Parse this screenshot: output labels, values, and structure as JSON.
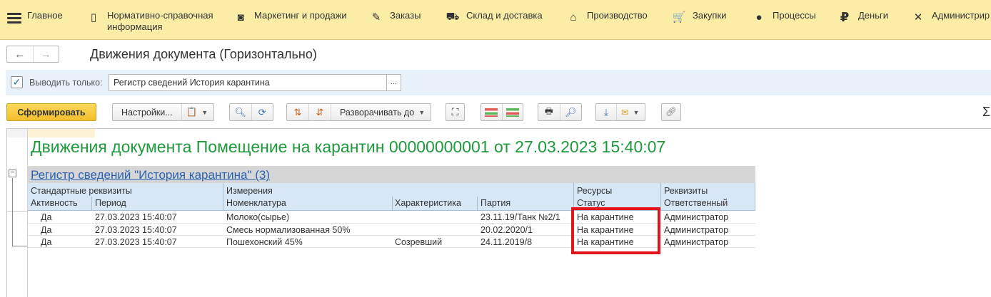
{
  "menu": {
    "items": [
      {
        "label": "Главное",
        "icon": "☰"
      },
      {
        "label": "Нормативно-справочная\nинформация",
        "icon": "▯"
      },
      {
        "label": "Маркетинг и продажи",
        "icon": "◙"
      },
      {
        "label": "Заказы",
        "icon": "✎"
      },
      {
        "label": "Склад и доставка",
        "icon": "⛟"
      },
      {
        "label": "Производство",
        "icon": "⌂"
      },
      {
        "label": "Закупки",
        "icon": "🛒"
      },
      {
        "label": "Процессы",
        "icon": "●"
      },
      {
        "label": "Деньги",
        "icon": "₽"
      },
      {
        "label": "Администрир",
        "icon": "✕"
      }
    ]
  },
  "title_bar": {
    "back": "←",
    "forward": "→",
    "title": "Движения документа (Горизонтально)"
  },
  "filter": {
    "checked": true,
    "check_mark": "✓",
    "label": "Выводить только:",
    "value": "Регистр сведений История карантина",
    "dots": "..."
  },
  "toolbar": {
    "generate_label": "Сформировать",
    "settings_label": "Настройки...",
    "expand_label": "Разворачивать до",
    "sigma": "Σ"
  },
  "report": {
    "title": "Движения документа Помещение на карантин 00000000001 от 27.03.2023 15:40:07",
    "group_title": "Регистр сведений \"История карантина\" (3)",
    "collapse_symbol": "−",
    "header_groups": [
      {
        "label": "Стандартные реквизиты"
      },
      {
        "label": "Измерения"
      },
      {
        "label": "Ресурсы"
      },
      {
        "label": "Реквизиты"
      }
    ],
    "columns": [
      "Активность",
      "Период",
      "Номенклатура",
      "Характеристика",
      "Партия",
      "Статус",
      "Ответственный"
    ],
    "rows": [
      [
        "Да",
        "27.03.2023 15:40:07",
        "Молоко(сырье)",
        "",
        "23.11.19/Танк №2/1",
        "На карантине",
        "Администратор"
      ],
      [
        "Да",
        "27.03.2023 15:40:07",
        "Смесь нормализованная 50%",
        "",
        "20.02.2020/1",
        "На карантине",
        "Администратор"
      ],
      [
        "Да",
        "27.03.2023 15:40:07",
        "Пошехонский 45%",
        "Созревший",
        "24.11.2019/8",
        "На карантине",
        "Администратор"
      ]
    ]
  },
  "colors": {
    "menu_bg": "#fbeca6",
    "report_title": "#1e9a3d",
    "link": "#2a63b2",
    "header_bg": "#d8e7f6",
    "highlight": "#e3141b",
    "primary_button": "#f3c02c"
  }
}
